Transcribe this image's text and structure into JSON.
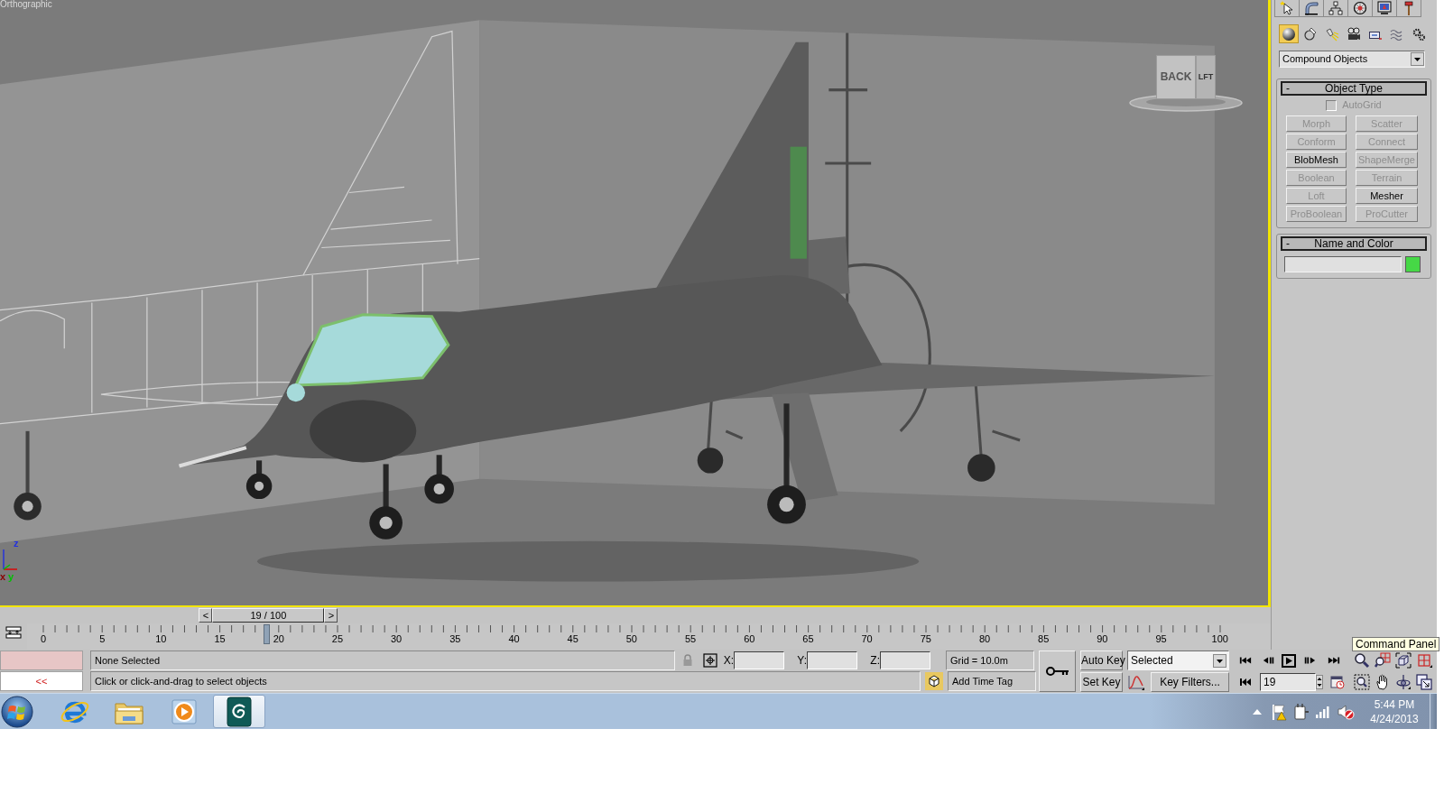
{
  "viewport": {
    "label": "Orthographic",
    "viewcube": {
      "faces": [
        {
          "kind": "back",
          "label": "BACK"
        },
        {
          "kind": "side",
          "label": "LFT"
        }
      ]
    },
    "axes": [
      {
        "kind": "z",
        "label": "z"
      },
      {
        "kind": "x",
        "label": "x"
      },
      {
        "kind": "y",
        "label": "y"
      }
    ]
  },
  "command_panel": {
    "categories": [
      {
        "kind": "geometry",
        "selected": true
      },
      {
        "kind": "shapes",
        "selected": false
      },
      {
        "kind": "lights",
        "selected": false
      },
      {
        "kind": "cameras",
        "selected": false
      },
      {
        "kind": "helpers",
        "selected": false
      },
      {
        "kind": "spacewarps",
        "selected": false
      },
      {
        "kind": "systems",
        "selected": false
      }
    ],
    "dropdown": {
      "value": "Compound Objects"
    },
    "object_type": {
      "toggle": "-",
      "title": "Object Type",
      "autogrid": {
        "label": "AutoGrid",
        "checked": false,
        "disabled": true
      },
      "buttons": [
        {
          "label": "Morph",
          "disabled": true
        },
        {
          "label": "Scatter",
          "disabled": true
        },
        {
          "label": "Conform",
          "disabled": true
        },
        {
          "label": "Connect",
          "disabled": true
        },
        {
          "label": "BlobMesh",
          "disabled": false
        },
        {
          "label": "ShapeMerge",
          "disabled": true
        },
        {
          "label": "Boolean",
          "disabled": true
        },
        {
          "label": "Terrain",
          "disabled": true
        },
        {
          "label": "Loft",
          "disabled": true
        },
        {
          "label": "Mesher",
          "disabled": false
        },
        {
          "label": "ProBoolean",
          "disabled": true
        },
        {
          "label": "ProCutter",
          "disabled": true
        }
      ]
    },
    "name_and_color": {
      "toggle": "-",
      "title": "Name and Color",
      "color": "#46d846"
    }
  },
  "tooltip": {
    "text": "Command Panel"
  },
  "timeline": {
    "slider": {
      "prev": "<",
      "label": "19 / 100",
      "next": ">",
      "level": 0.19
    },
    "ruler_labels": [
      "0",
      "5",
      "10",
      "15",
      "20",
      "25",
      "30",
      "35",
      "40",
      "45",
      "50",
      "55",
      "60",
      "65",
      "70",
      "75",
      "80",
      "85",
      "90",
      "95",
      "100"
    ]
  },
  "status_bar": {
    "listener_prompt": "<<",
    "selection": "None Selected",
    "prompt": "Click or click-and-drag to select objects",
    "coordinates": [
      {
        "label": "X:"
      },
      {
        "label": "Y:"
      },
      {
        "label": "Z:"
      }
    ],
    "grid": "Grid = 10.0m",
    "time_tag": "Add Time Tag",
    "auto_key": "Auto Key",
    "set_key": "Set Key",
    "key_set": {
      "value": "Selected"
    },
    "key_filters": "Key Filters...",
    "frame": {
      "value": "19"
    }
  },
  "taskbar": {
    "apps": [
      {
        "kind": "browser",
        "selected": false
      },
      {
        "kind": "folder",
        "selected": false
      },
      {
        "kind": "media",
        "selected": false
      },
      {
        "kind": "max",
        "selected": true
      }
    ],
    "clock": {
      "time": "5:44 PM",
      "date": "4/24/2013"
    }
  }
}
